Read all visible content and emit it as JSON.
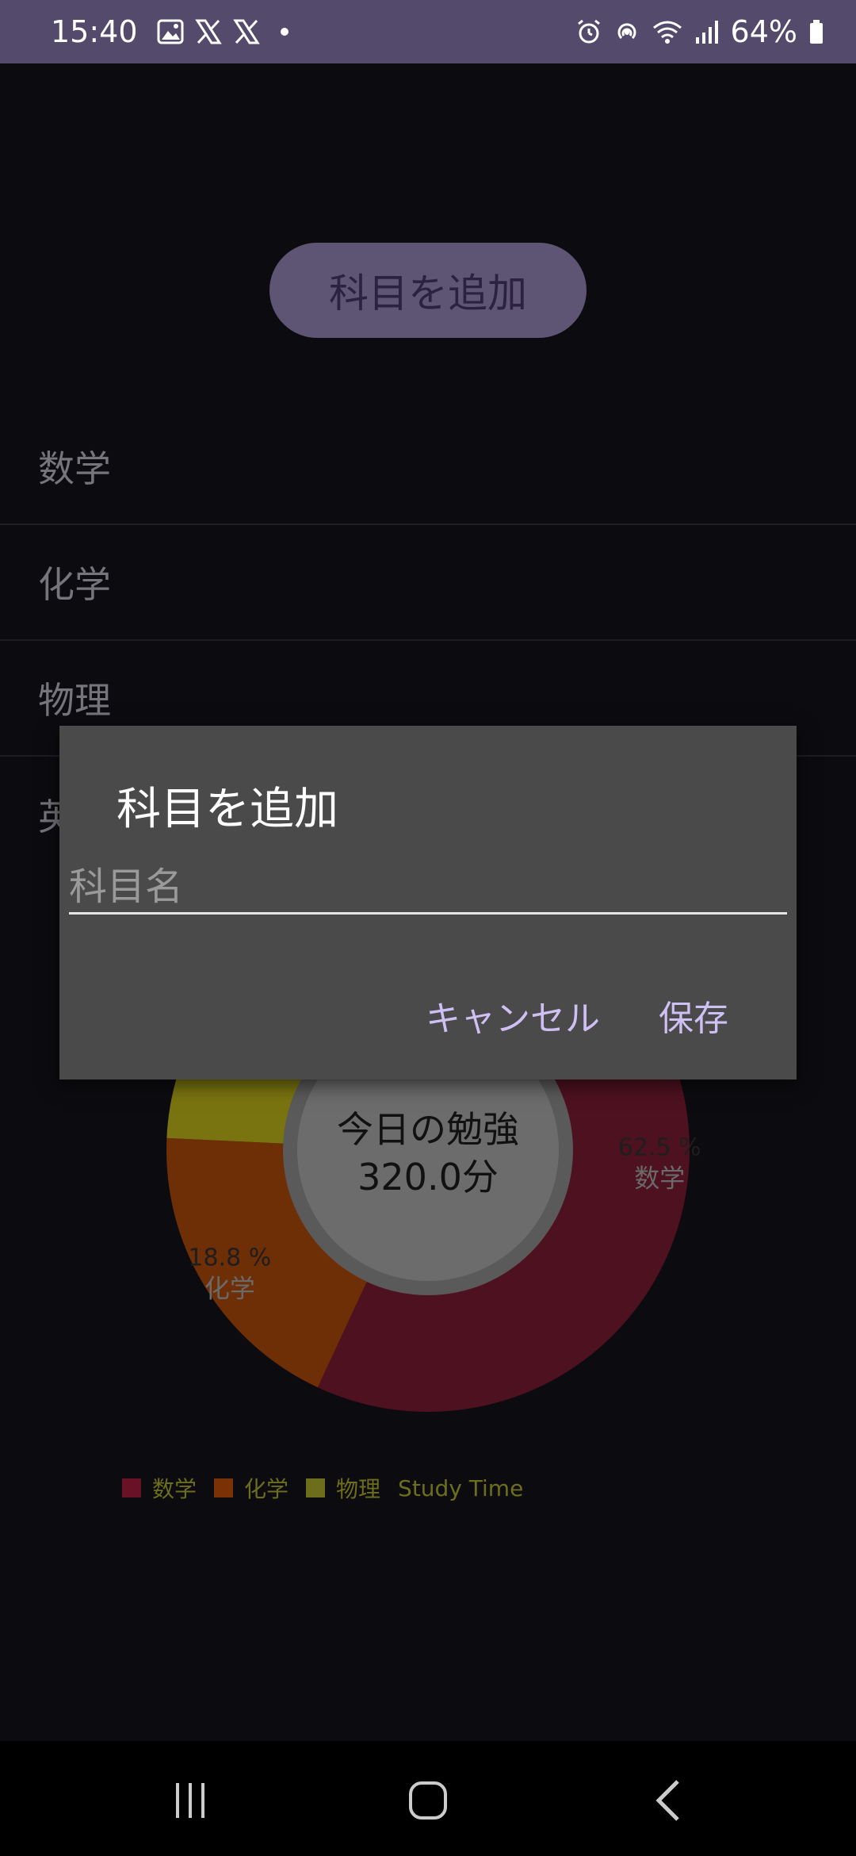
{
  "status_bar": {
    "time": "15:40",
    "battery": "64%",
    "left_icons": [
      "image-icon",
      "x-logo-icon",
      "x-logo-icon",
      "dot-icon"
    ],
    "right_icons": [
      "alarm-icon",
      "hotspot-icon",
      "wifi-icon",
      "signal-icon",
      "battery-icon"
    ]
  },
  "app": {
    "add_button_label": "科目を追加",
    "subjects": [
      "数学",
      "化学",
      "物理",
      "英"
    ]
  },
  "chart_data": {
    "type": "pie",
    "title": "",
    "center_text_line1": "今日の勉強",
    "center_text_line2": "320.0分",
    "slices": [
      {
        "label": "数学",
        "percent": 62.5,
        "percent_label": "62.5 %",
        "color": "#4e1120"
      },
      {
        "label": "化学",
        "percent": 18.8,
        "percent_label": "18.8 %",
        "color": "#6e2e06"
      },
      {
        "label": "物理",
        "percent": 18.7,
        "percent_label": "",
        "color": "#7a7410"
      }
    ],
    "legend": {
      "items": [
        {
          "label": "数学",
          "color": "#6a1225"
        },
        {
          "label": "化学",
          "color": "#7a3106"
        },
        {
          "label": "物理",
          "color": "#6d6e1c"
        }
      ],
      "series_name": "Study Time",
      "placement": "bottom-left"
    }
  },
  "dialog": {
    "title": "科目を追加",
    "input_placeholder": "科目名",
    "cancel_label": "キャンセル",
    "save_label": "保存"
  },
  "nav_bar": {
    "icons": [
      "recent-apps-icon",
      "home-icon",
      "back-icon"
    ]
  },
  "colors": {
    "status_bar_bg": "#544b6c",
    "app_bg": "#0c0b0f",
    "dialog_bg": "#4a4a4a",
    "accent_text": "#cfc0f4"
  }
}
